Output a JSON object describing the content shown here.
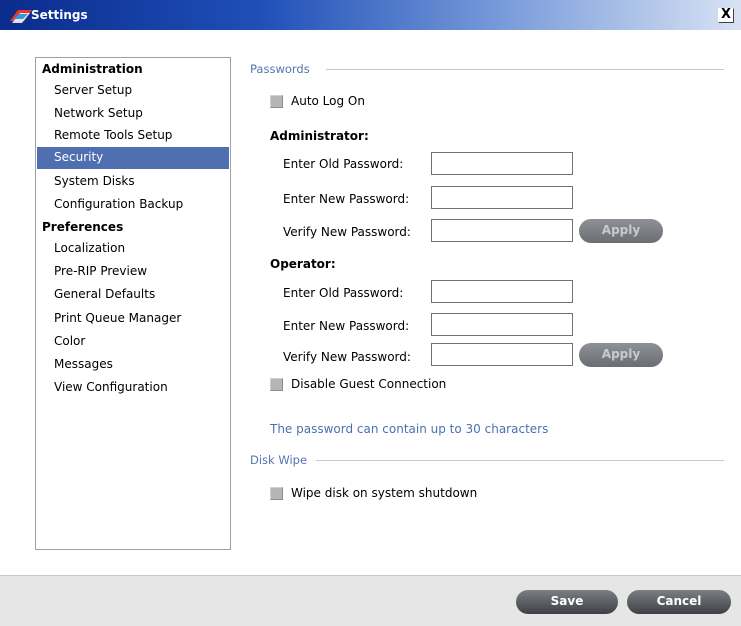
{
  "window": {
    "title": "Settings",
    "close_glyph": "X"
  },
  "nav": {
    "groups": [
      {
        "header": "Administration",
        "items": [
          "Server Setup",
          "Network Setup",
          "Remote Tools Setup",
          "Security",
          "System Disks",
          "Configuration Backup"
        ]
      },
      {
        "header": "Preferences",
        "items": [
          "Localization",
          "Pre-RIP Preview",
          "General Defaults",
          "Print Queue Manager",
          "Color",
          "Messages",
          "View Configuration"
        ]
      }
    ],
    "selected": "Security"
  },
  "passwords": {
    "section_label": "Passwords",
    "auto_log_on": {
      "label": "Auto Log On",
      "checked": false
    },
    "administrator": {
      "title": "Administrator:",
      "old_label": "Enter Old Password:",
      "new_label": "Enter New Password:",
      "verify_label": "Verify New Password:",
      "old_value": "",
      "new_value": "",
      "verify_value": "",
      "apply_label": "Apply"
    },
    "operator": {
      "title": "Operator:",
      "old_label": "Enter Old Password:",
      "new_label": "Enter New Password:",
      "verify_label": "Verify New Password:",
      "old_value": "",
      "new_value": "",
      "verify_value": "",
      "apply_label": "Apply"
    },
    "disable_guest": {
      "label": "Disable Guest Connection",
      "checked": false
    },
    "info": "The password can contain up to 30 characters"
  },
  "disk_wipe": {
    "section_label": "Disk Wipe",
    "wipe_on_shutdown": {
      "label": "Wipe disk on system shutdown",
      "checked": false
    }
  },
  "footer": {
    "save_label": "Save",
    "cancel_label": "Cancel"
  },
  "colors": {
    "accent": "#506fb0",
    "section_label": "#5574b0",
    "info_text": "#4a71b0",
    "title_bar": "#0a2c8c"
  },
  "icons": [
    "app-logo-icon",
    "close-icon",
    "checkbox-icon"
  ]
}
